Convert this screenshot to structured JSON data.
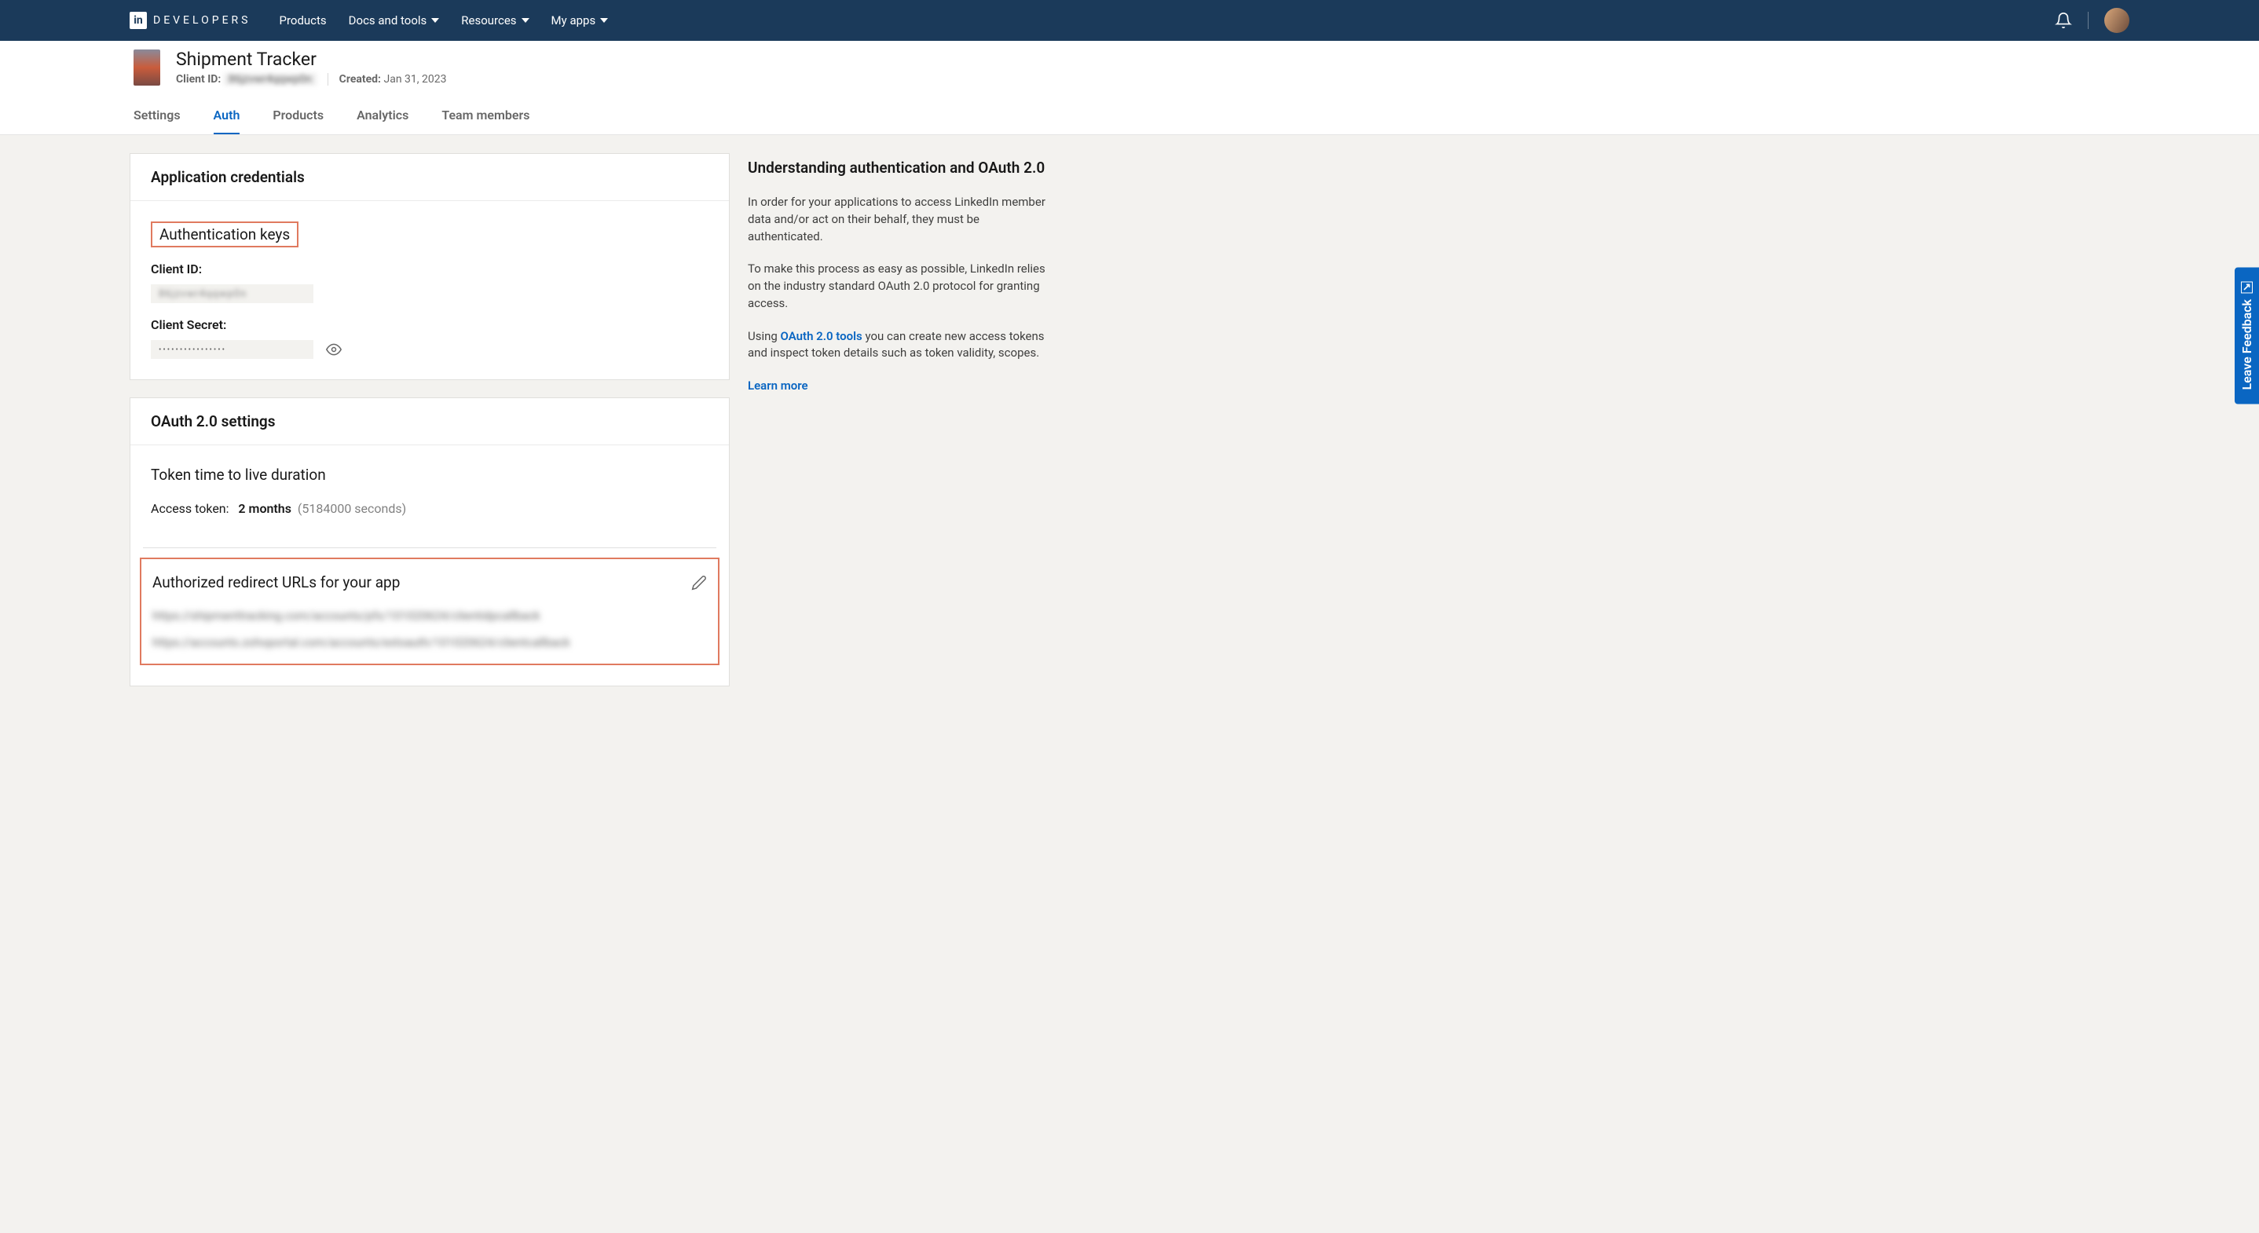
{
  "nav": {
    "logo_text": "DEVELOPERS",
    "products": "Products",
    "docs": "Docs and tools",
    "resources": "Resources",
    "myapps": "My apps"
  },
  "app": {
    "title": "Shipment Tracker",
    "client_id_label": "Client ID:",
    "client_id_value": "86jzvwr4qqwp0n",
    "created_label": "Created:",
    "created_value": "Jan 31, 2023"
  },
  "tabs": {
    "settings": "Settings",
    "auth": "Auth",
    "products": "Products",
    "analytics": "Analytics",
    "team": "Team members"
  },
  "credentials": {
    "card_title": "Application credentials",
    "auth_keys": "Authentication keys",
    "client_id_label": "Client ID:",
    "client_id_value": "86jzvwr4qqwp0n",
    "client_secret_label": "Client Secret:",
    "client_secret_value": "••••••••••••••••"
  },
  "oauth": {
    "card_title": "OAuth 2.0 settings",
    "ttl_title": "Token time to live duration",
    "access_token_label": "Access token:",
    "access_token_value": "2 months",
    "access_token_seconds": "(5184000 seconds)",
    "redirect_title": "Authorized redirect URLs for your app",
    "urls": [
      "https://shipmenttracking.com/accounts/pfx/101020624/clientidpcallback",
      "https://accounts.zohoportal.com/accounts/extoauth/101020624/clientcallback"
    ]
  },
  "side": {
    "title": "Understanding authentication and OAuth 2.0",
    "p1": "In order for your applications to access LinkedIn member data and/or act on their behalf, they must be authenticated.",
    "p2": "To make this process as easy as possible, LinkedIn relies on the industry standard OAuth 2.0 protocol for granting access.",
    "p3a": "Using ",
    "p3link": "OAuth 2.0 tools",
    "p3b": " you can create new access tokens and inspect token details such as token validity, scopes.",
    "learn": "Learn more"
  },
  "feedback": "Leave Feedback"
}
